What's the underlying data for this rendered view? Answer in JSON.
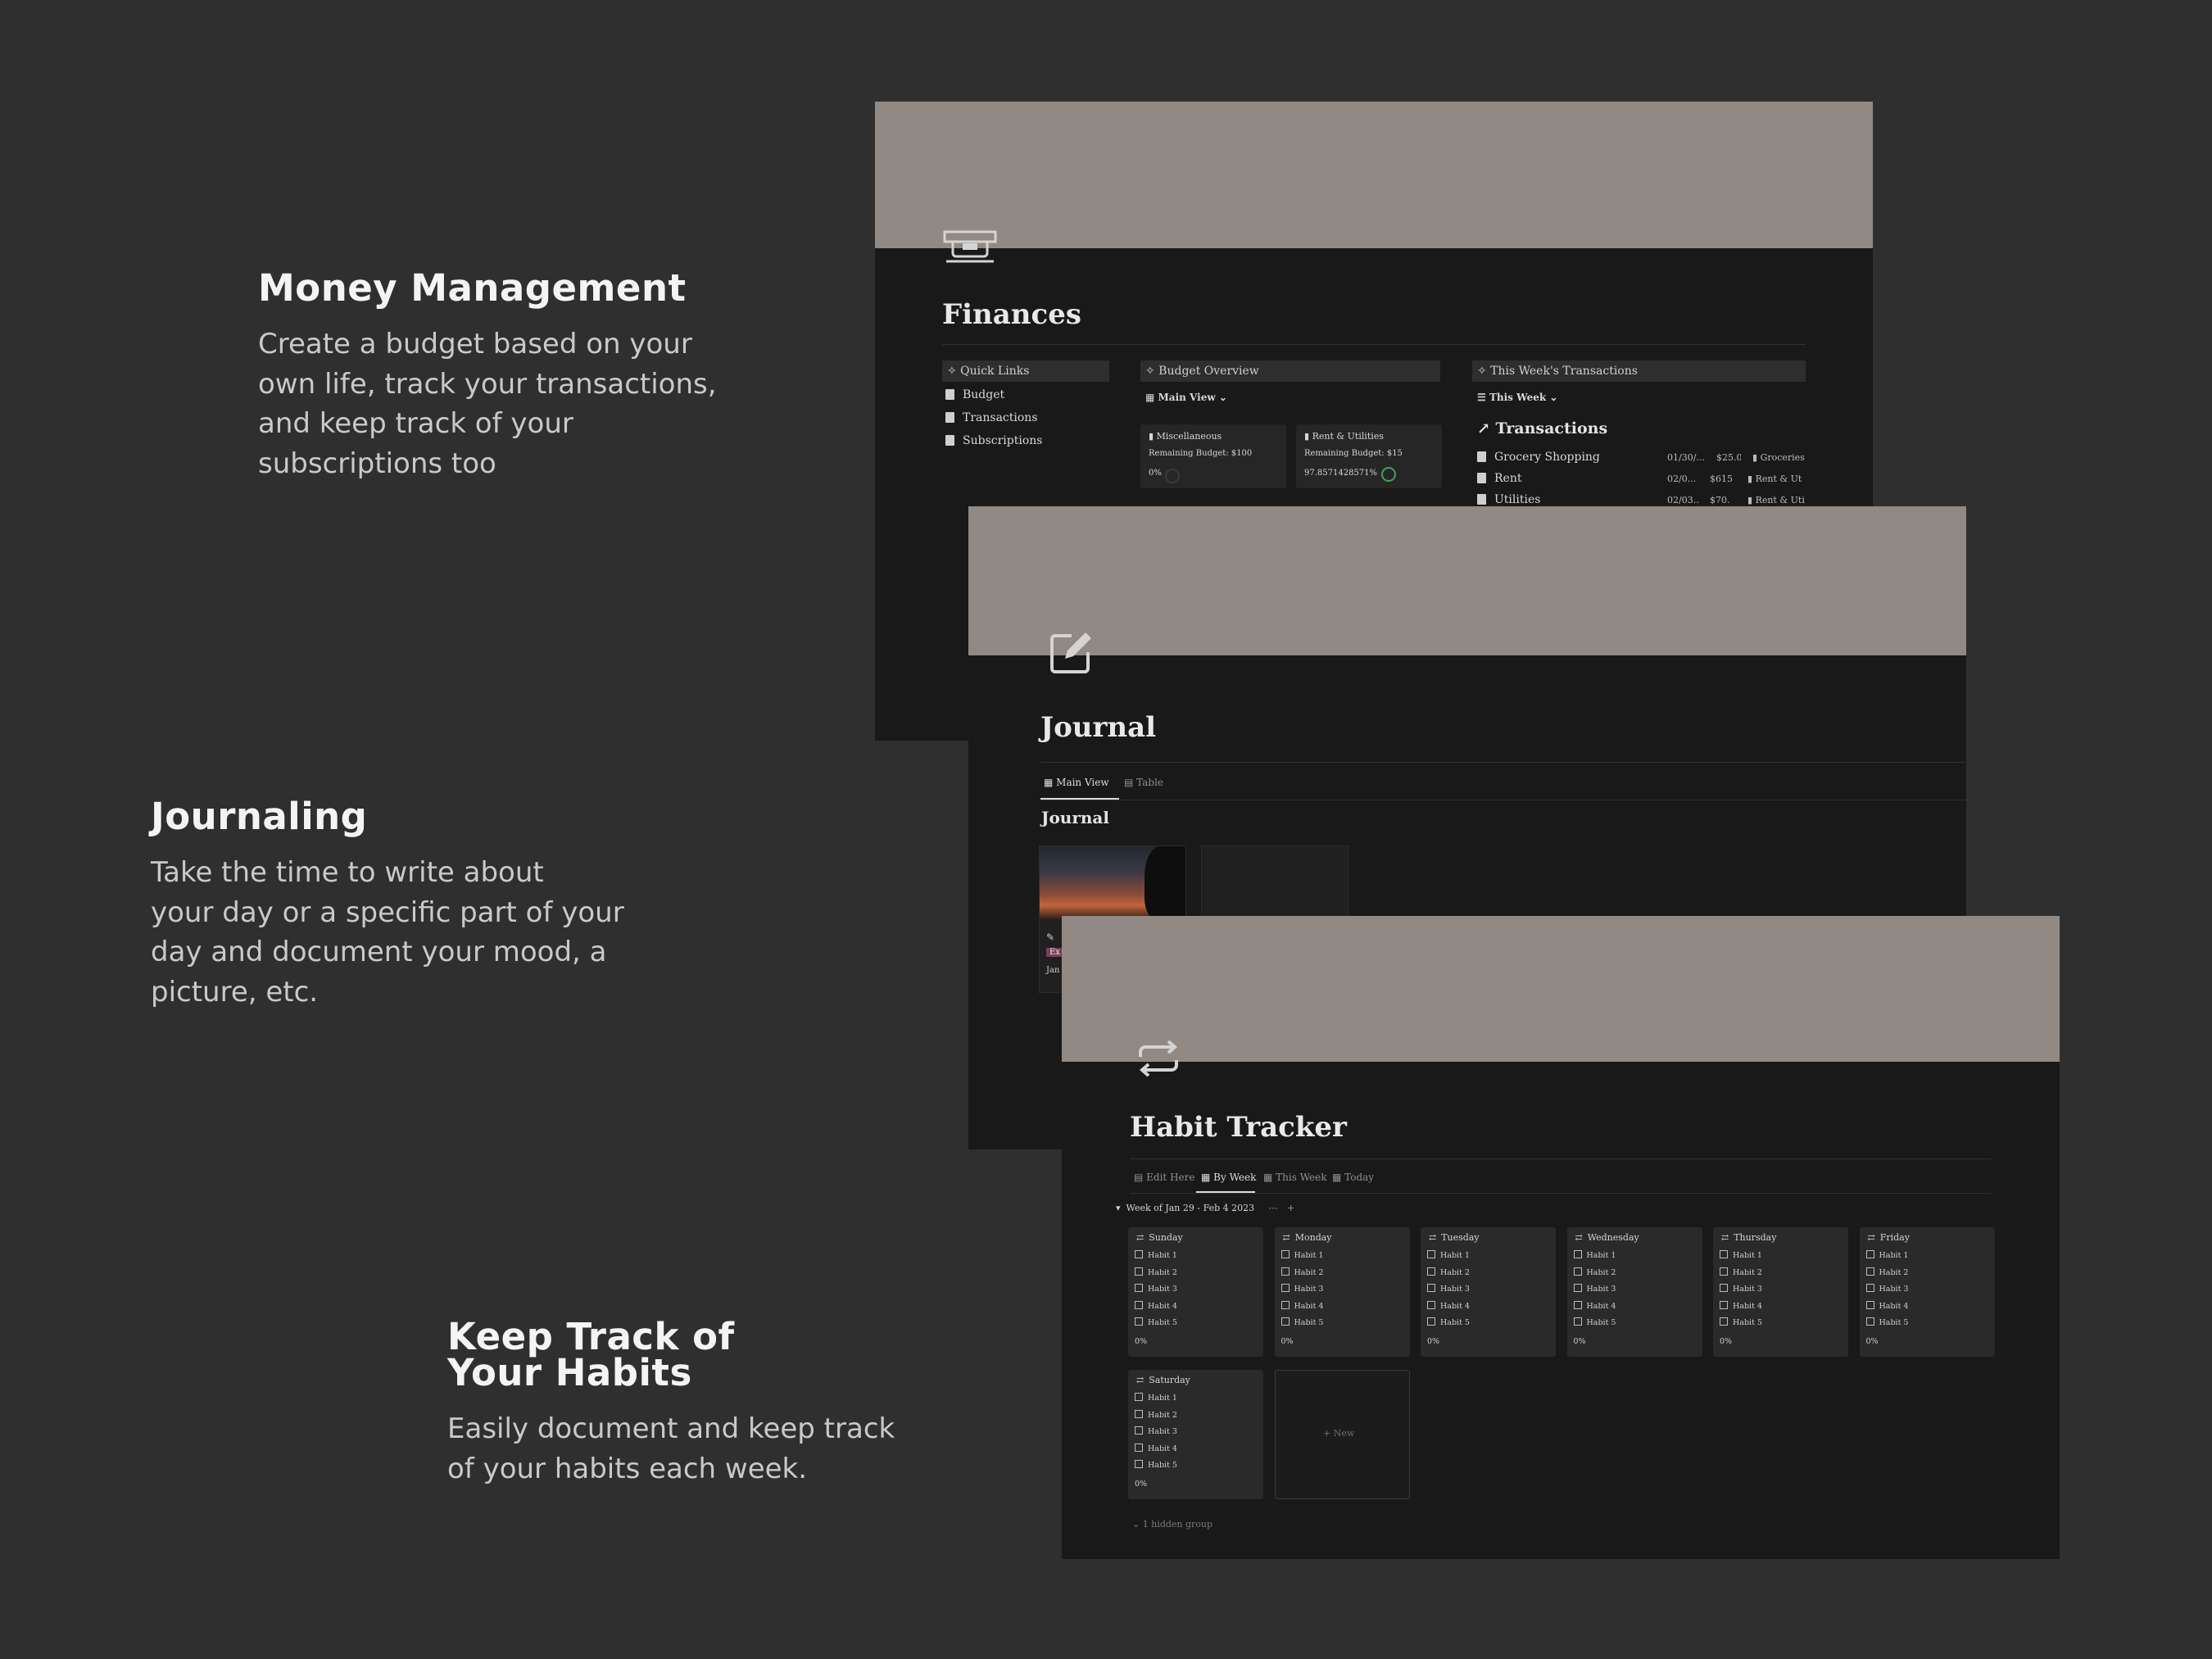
{
  "sections": {
    "money": {
      "heading": "Money Management",
      "body": [
        "Create a budget based on your",
        "own life, track your transactions,",
        "and keep track of your",
        "subscriptions too"
      ]
    },
    "journal": {
      "heading": "Journaling",
      "body": [
        "Take the time to write about",
        "your day or a specific part of your",
        "day and document your mood, a",
        "picture, etc."
      ]
    },
    "habits": {
      "heading_lines": [
        "Keep Track of",
        "Your Habits"
      ],
      "body": [
        "Easily document and keep track",
        "of your habits each week."
      ]
    }
  },
  "finances": {
    "title": "Finances",
    "icon": "cash-register-icon",
    "quick_links": {
      "heading": "✧ Quick Links",
      "items": [
        "Budget",
        "Transactions",
        "Subscriptions"
      ]
    },
    "budget_overview": {
      "heading": "✧ Budget Overview",
      "view": "Main View",
      "cards": [
        {
          "name": "Miscellaneous",
          "remaining": "Remaining Budget: $100",
          "percent": "0%"
        },
        {
          "name": "Rent & Utilities",
          "remaining": "Remaining Budget: $15",
          "percent": "97.8571428571%"
        }
      ]
    },
    "transactions": {
      "heading": "✧ This Week's Transactions",
      "view": "This Week",
      "title": "↗ Transactions",
      "rows": [
        {
          "name": "Grocery Shopping",
          "date": "01/30/...",
          "amount": "$25.0",
          "category": "Groceries"
        },
        {
          "name": "Rent",
          "date": "02/0...",
          "amount": "$615",
          "category": "Rent & Ut"
        },
        {
          "name": "Utilities",
          "date": "02/03...",
          "amount": "$70.",
          "category": "Rent & Uti"
        }
      ]
    }
  },
  "journal": {
    "title": "Journal",
    "icon": "edit-icon",
    "tabs": [
      "Main View",
      "Table"
    ],
    "subtitle": "Journal",
    "card_tag": "Ex",
    "card_date": "Jan"
  },
  "habit_tracker": {
    "title": "Habit Tracker",
    "icon": "repeat-icon",
    "tabs": [
      "Edit Here",
      "By Week",
      "This Week",
      "Today"
    ],
    "week_label": "Week of Jan 29 - Feb 4 2023",
    "days": [
      "Sunday",
      "Monday",
      "Tuesday",
      "Wednesday",
      "Thursday",
      "Friday",
      "Saturday"
    ],
    "habits": [
      "Habit 1",
      "Habit 2",
      "Habit 3",
      "Habit 4",
      "Habit 5"
    ],
    "percent": "0%",
    "new_label": "+ New",
    "hidden_group": "1 hidden group"
  },
  "colors": {
    "background": "#2f2f2f",
    "panel": "#191919",
    "cover": "#918983"
  }
}
